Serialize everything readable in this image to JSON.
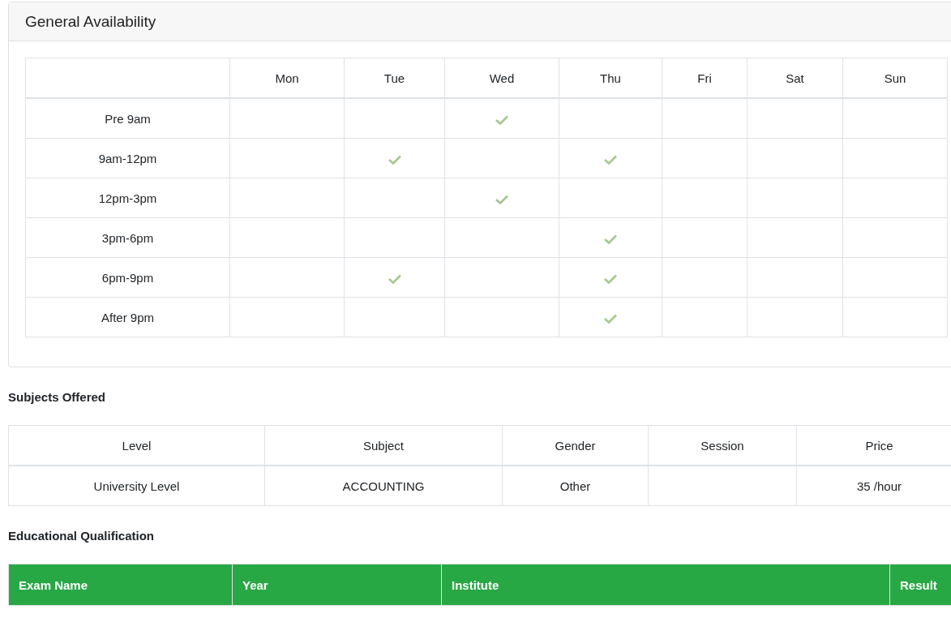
{
  "availability": {
    "title": "General Availability",
    "days": [
      "Mon",
      "Tue",
      "Wed",
      "Thu",
      "Fri",
      "Sat",
      "Sun"
    ],
    "slots": [
      {
        "label": "Pre 9am",
        "checked": [
          false,
          false,
          true,
          false,
          false,
          false,
          false
        ]
      },
      {
        "label": "9am-12pm",
        "checked": [
          false,
          true,
          false,
          true,
          false,
          false,
          false
        ]
      },
      {
        "label": "12pm-3pm",
        "checked": [
          false,
          false,
          true,
          false,
          false,
          false,
          false
        ]
      },
      {
        "label": "3pm-6pm",
        "checked": [
          false,
          false,
          false,
          true,
          false,
          false,
          false
        ]
      },
      {
        "label": "6pm-9pm",
        "checked": [
          false,
          true,
          false,
          true,
          false,
          false,
          false
        ]
      },
      {
        "label": "After 9pm",
        "checked": [
          false,
          false,
          false,
          true,
          false,
          false,
          false
        ]
      }
    ]
  },
  "subjects": {
    "title": "Subjects Offered",
    "columns": [
      "Level",
      "Subject",
      "Gender",
      "Session",
      "Price"
    ],
    "rows": [
      [
        "University Level",
        "ACCOUNTING",
        "Other",
        "",
        "35 /hour"
      ]
    ]
  },
  "education": {
    "title": "Educational Qualification",
    "columns": [
      "Exam Name",
      "Year",
      "Institute",
      "Result"
    ]
  }
}
